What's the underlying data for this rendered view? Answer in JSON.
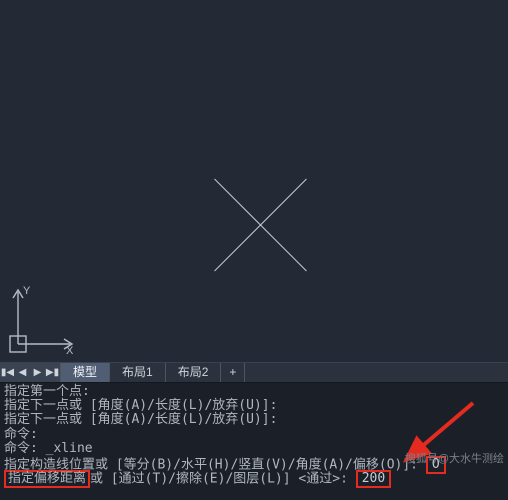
{
  "viewport": {
    "axis_y_label": "Y",
    "axis_x_label": "X"
  },
  "tabs": {
    "nav": {
      "first": "▮◀",
      "prev": "◀",
      "next": "▶",
      "last": "▶▮"
    },
    "items": [
      {
        "label": "模型",
        "active": true
      },
      {
        "label": "布局1",
        "active": false
      },
      {
        "label": "布局2",
        "active": false
      }
    ],
    "add": "+"
  },
  "command": {
    "lines": [
      "指定第一个点:",
      "指定下一点或 [角度(A)/长度(L)/放弃(U)]:",
      "指定下一点或 [角度(A)/长度(L)/放弃(U)]:",
      "命令:",
      "命令: _xline",
      "指定构造线位置或 [等分(B)/水平(H)/竖直(V)/角度(A)/偏移(O)]: "
    ],
    "input_o": "O",
    "last_prefix": "指定偏移距离",
    "last_mid": "或 [通过(T)/擦除(E)/图层(L)] <通过>: ",
    "input_200": "200"
  },
  "watermark": "搜狐号@大水牛测绘"
}
